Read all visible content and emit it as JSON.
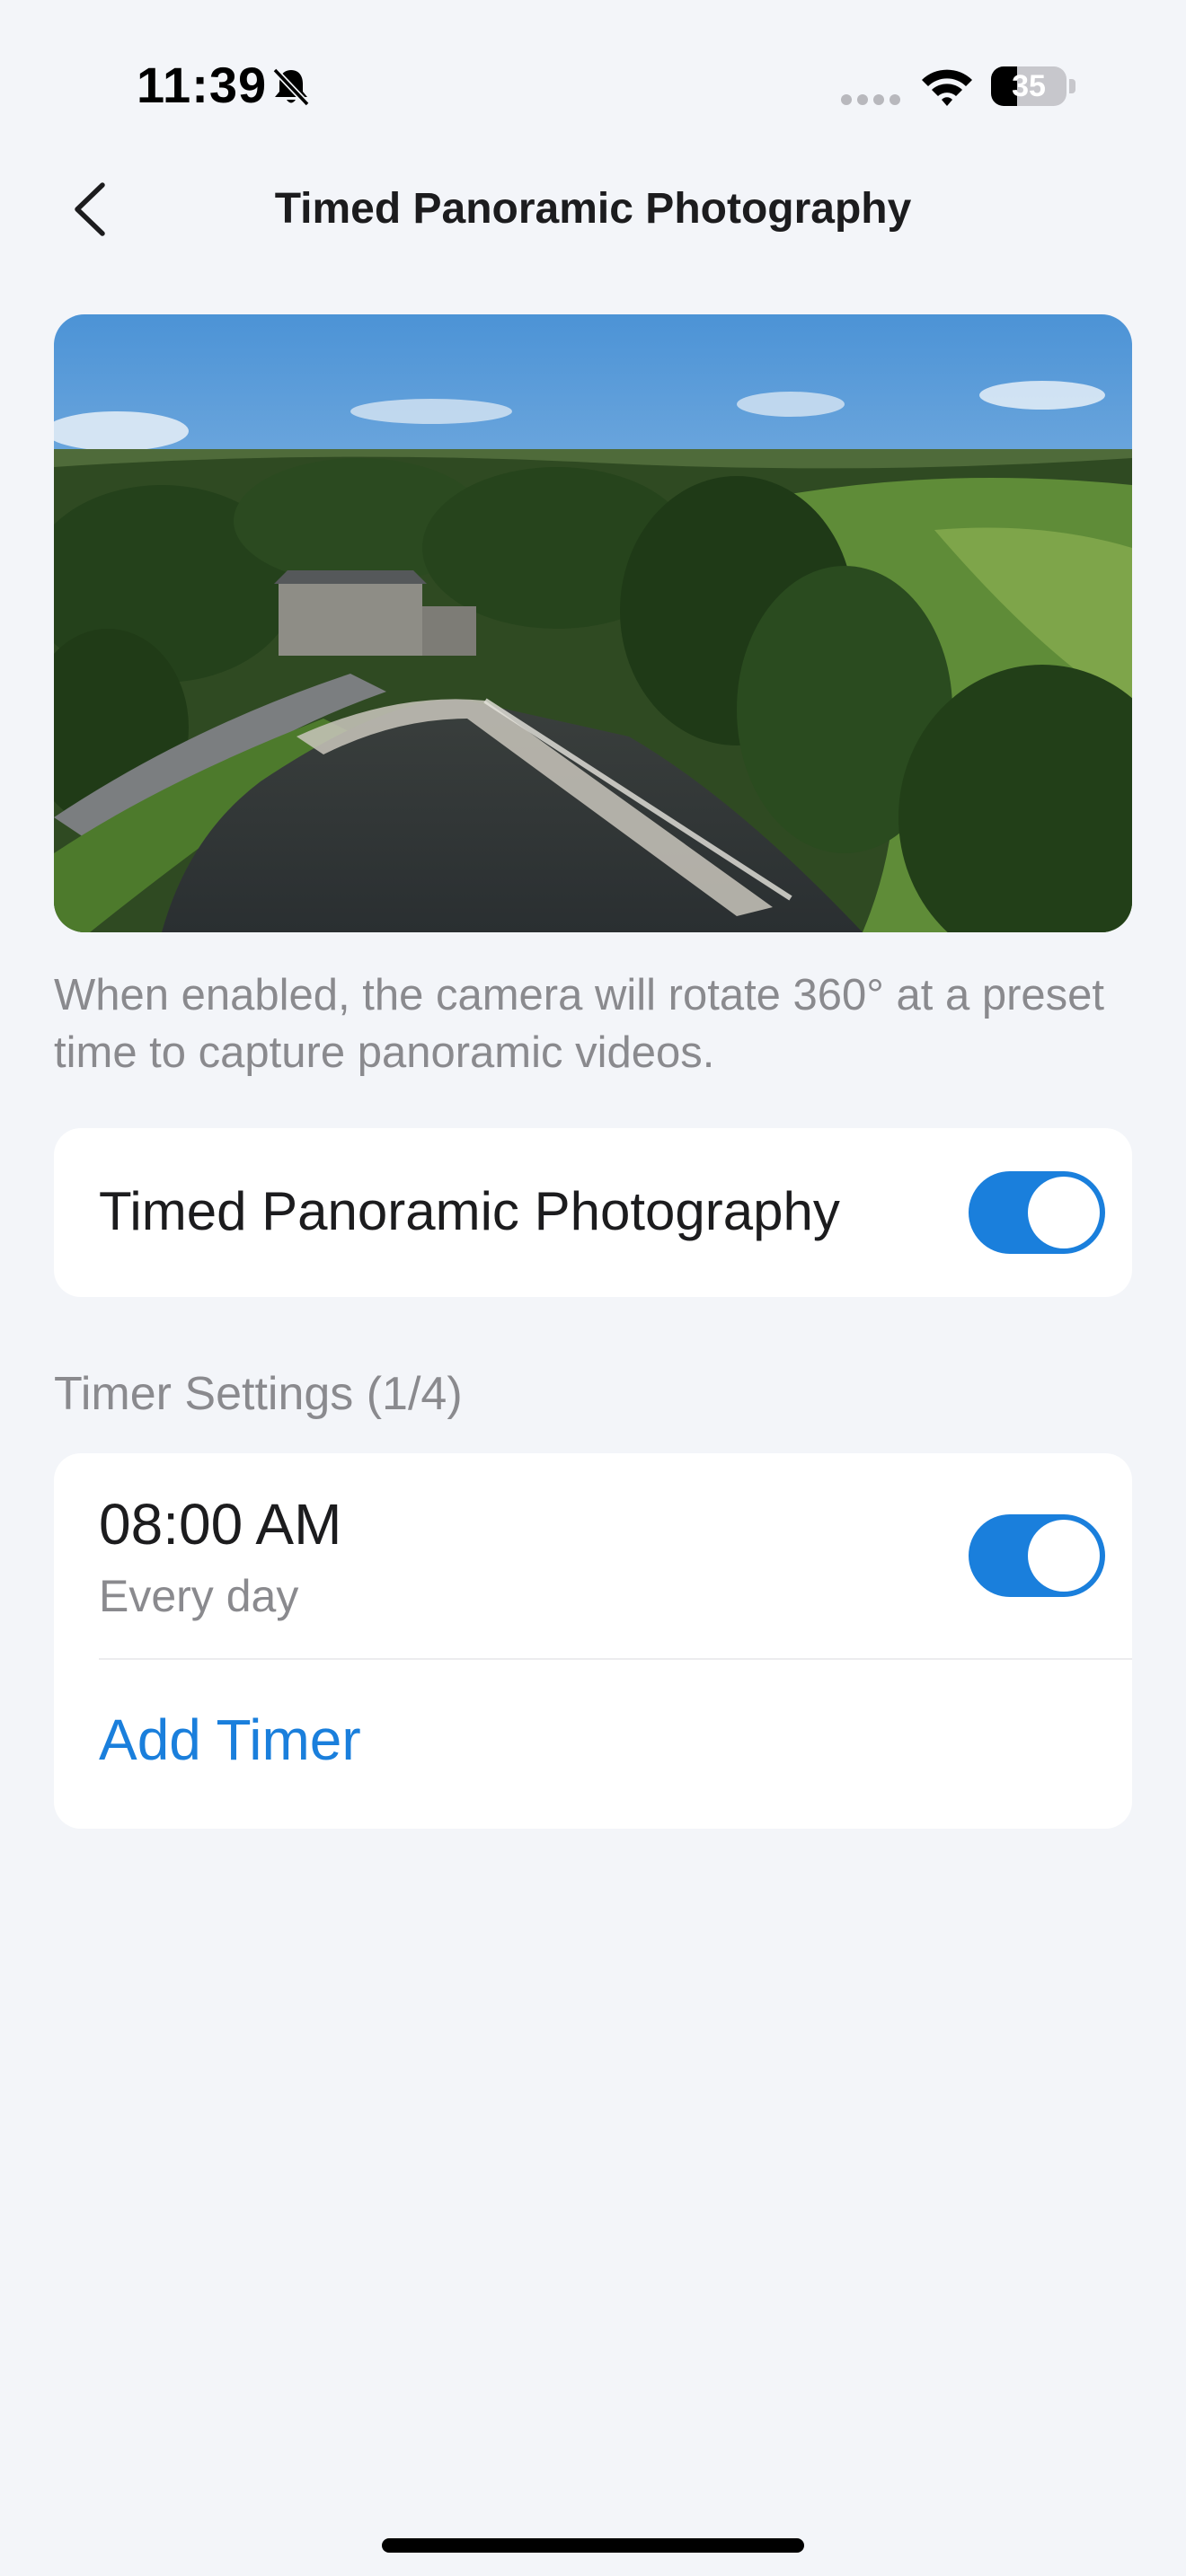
{
  "status_bar": {
    "time": "11:39",
    "battery_level": "35",
    "battery_fraction": 0.35,
    "icons": [
      "bell-muted-icon",
      "signal-icon",
      "wifi-icon",
      "battery-icon"
    ]
  },
  "nav": {
    "title": "Timed Panoramic Photography",
    "back_icon": "chevron-left-icon"
  },
  "preview": {
    "image": "aerial river landscape photo"
  },
  "description": "When enabled, the camera will rotate 360° at a preset time to capture panoramic videos.",
  "main_toggle": {
    "label": "Timed Panoramic Photography",
    "enabled": true
  },
  "timer_settings": {
    "title": "Timer Settings (1/4)",
    "timers": [
      {
        "time": "08:00 AM",
        "repeat": "Every day",
        "enabled": true
      }
    ],
    "add_label": "Add Timer"
  },
  "colors": {
    "accent": "#1a7fdc",
    "background": "#f3f5f9",
    "card": "#ffffff",
    "secondary_text": "#8a8a8e"
  }
}
